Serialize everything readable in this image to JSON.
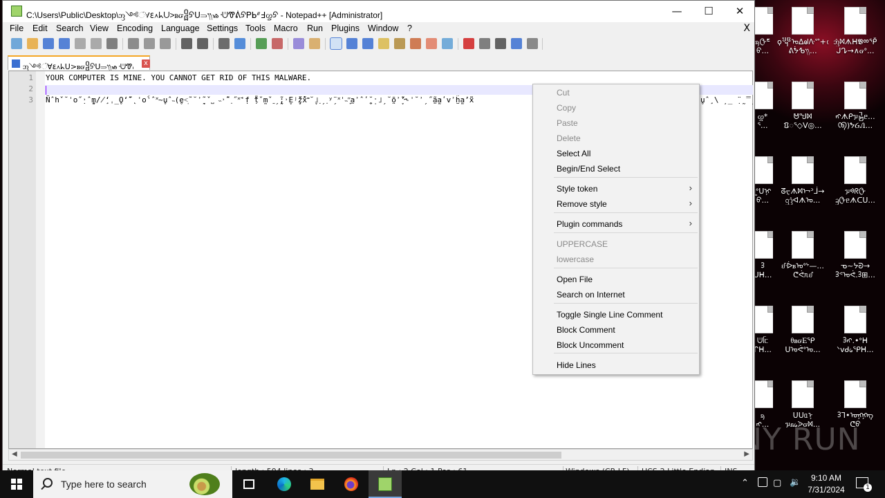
{
  "window": {
    "title": "C:\\Users\\Public\\Desktop\\ᦀ༺ᜲ∀ᰚ᧘ᖾᑌ>ᏼᏻ᧠ᠫᑌ⥰᭟ᏹ᠂ᕫᏡᕖᠫᏢᖯᐥ߃ᦄᠫ - Notepad++ [Administrator]",
    "minimize": "—",
    "maximize": "☐",
    "close": "✕"
  },
  "menu": {
    "items": [
      "File",
      "Edit",
      "Search",
      "View",
      "Encoding",
      "Language",
      "Settings",
      "Tools",
      "Macro",
      "Run",
      "Plugins",
      "Window",
      "?"
    ],
    "close_doc": "X"
  },
  "toolbar": {
    "icons": [
      "new-file-icon",
      "open-file-icon",
      "save-icon",
      "save-all-icon",
      "close-icon",
      "close-all-icon",
      "print-icon",
      "cut-icon",
      "copy-icon",
      "paste-icon",
      "undo-icon",
      "redo-icon",
      "find-icon",
      "replace-icon",
      "zoom-in-icon",
      "zoom-out-icon",
      "sync-v-icon",
      "sync-h-icon",
      "word-wrap-icon",
      "all-chars-icon",
      "indent-guide-icon",
      "udl-icon",
      "doc-map-icon",
      "function-list-icon",
      "folder-workspace-icon",
      "monitor-icon",
      "record-macro-icon",
      "stop-macro-icon",
      "play-macro-icon",
      "run-macro-multiple-icon",
      "save-macro-icon"
    ]
  },
  "tab": {
    "label": "ᦀ༺ᜲ∀ᰚ᧘ᖾᑌ>ᏼᏻ᧠ᠫᑌ⥰᭟ᏹ᠂ᕫᏡᕖᠫᏢᖯᐥ߃ᦄᠫ",
    "close": "x"
  },
  "editor": {
    "lines": [
      {
        "num": "1",
        "text": "YOUR COMPUTER IS MINE. YOU CANNOT GET RID OF THIS MALWARE."
      },
      {
        "num": "2",
        "text": ""
      },
      {
        "num": "3",
        "text": "N̈ˆhˇ˘ˈo˝̣˒ˆm̰̥/̸̧ʻˌ̲O̥ʻ̈́˜˛ˈoˁˆ˟~u̥ˆ˵(̥e˂̩˜˘ʾ̩̯˜ˇ˽ ˵˒̃ˆ˰˝˟̃ˈ̣f ̣̃̃t̃ˇm̰ˇ˷ˏ̣̰̃;˒E̞ʲ̧̋ž̞x̃̓˭˘̞˩˯ˏ˰ʸ̈ˏ˟ˈ˵ʺ̟̣a̤ʾˆʹ̤̥˘̩ˑ˩ˏ˘õ̤ʾ̞̃ʼ˞ˈ˘ʾˏ˝̃a̤a̰ʹvʾh̤̤̃a̰ʼx̃̃"
      },
      {
        "num": "",
        "text": "u̥ˆ̧ \\ ̦ ̲ ̣̈ ̰ ̿ˏ̵ ̰̃"
      }
    ]
  },
  "status": {
    "type": "Normal text file",
    "length": "length : 594    lines : 3",
    "position": "Ln : 2    Col : 1    Pos : 61",
    "eol": "Windows (CR LF)",
    "encoding": "UCS-2 Little Endian",
    "mode": "INS"
  },
  "context_menu": {
    "items": [
      {
        "label": "Cut",
        "enabled": false
      },
      {
        "label": "Copy",
        "enabled": false
      },
      {
        "label": "Paste",
        "enabled": false
      },
      {
        "label": "Delete",
        "enabled": false
      },
      {
        "label": "Select All",
        "enabled": true
      },
      {
        "label": "Begin/End Select",
        "enabled": true
      },
      {
        "label": "Style token",
        "enabled": true,
        "submenu": true
      },
      {
        "label": "Remove style",
        "enabled": true,
        "submenu": true
      },
      {
        "label": "Plugin commands",
        "enabled": true,
        "submenu": true
      },
      {
        "label": "UPPERCASE",
        "enabled": false
      },
      {
        "label": "lowercase",
        "enabled": false
      },
      {
        "label": "Open File",
        "enabled": true
      },
      {
        "label": "Search on Internet",
        "enabled": true
      },
      {
        "label": "Toggle Single Line Comment",
        "enabled": true
      },
      {
        "label": "Block Comment",
        "enabled": true
      },
      {
        "label": "Block Uncomment",
        "enabled": true
      },
      {
        "label": "Hide Lines",
        "enabled": true
      }
    ]
  },
  "desktop": {
    "icons": [
      {
        "l1": "ᦣᠿᖟ",
        "l2": "ᠪ..."
      },
      {
        "l1": "ϙ᧯ᠣ∆ᖙᐽᔥ+᪄",
        "l2": "ᕕᖭᕹ᭟..."
      },
      {
        "l1": "ᦁᢂᗑᕼ𝖁ᢁᕾ",
        "l2": "ᒍᖊ→∧ᏻᐤ..."
      },
      {
        "l1": "ᦄ*",
        "l2": "ᕐ..."
      },
      {
        "l1": "ᕰᖑᢂ",
        "l2": "ᱯᢅᕐ◇V◎..."
      },
      {
        "l1": "ᠩᗑᑭᥭ᧲ᥱ...",
        "l2": "ᢗᠪ)ᖬᏵᏁ..."
      },
      {
        "l1": "ᥧᐤᑌᢊ",
        "l2": "ᠪ..."
      },
      {
        "l1": "ᘔᠸᗑᢂᢇᐣᒨ→",
        "l2": "ᦋᦤᐊᗑᠣ..."
      },
      {
        "l1": "ᥭᢀᖇᠿ",
        "l2": "ᦃᠿᥱᗑᑕᑌ..."
      },
      {
        "l1": "ᢃ",
        "l2": "ᑌᕼ..."
      },
      {
        "l1": "ᦊᐔᏼᠣᐤᔾ—...",
        "l2": "ᕦᕚᥰᦊ"
      },
      {
        "l1": "ᓀ~ᔭᘐ→",
        "l2": "ᢃᕝᠣᕚ.ᢃ⊞..."
      },
      {
        "l1": "ᕫᥬᥴ",
        "l2": "ᒋᕼ..."
      },
      {
        "l1": "ᦲᏼᏻᎬᕿ",
        "l2": "ᑌᠣᕚᐤᠣ..."
      },
      {
        "l1": "ᢃᠩ.•ᐤᕼ",
        "l2": "ᐠvᑯ᥀ᕿᕼ..."
      },
      {
        "l1": "ᦣ",
        "l2": "ᠩ..."
      },
      {
        "l1": "ᑌᑌᥲᠨ",
        "l2": "ᥭᏺ᥀ᐷᏻᢂ..."
      },
      {
        "l1": "ᢃᒣ•ᠣᢊᢊᠩ",
        "l2": "ᕦᠪ"
      }
    ],
    "watermark": "ANY RUN"
  },
  "taskbar": {
    "search_placeholder": "Type here to search",
    "time": "9:10 AM",
    "date": "7/31/2024",
    "notification_count": "1"
  }
}
